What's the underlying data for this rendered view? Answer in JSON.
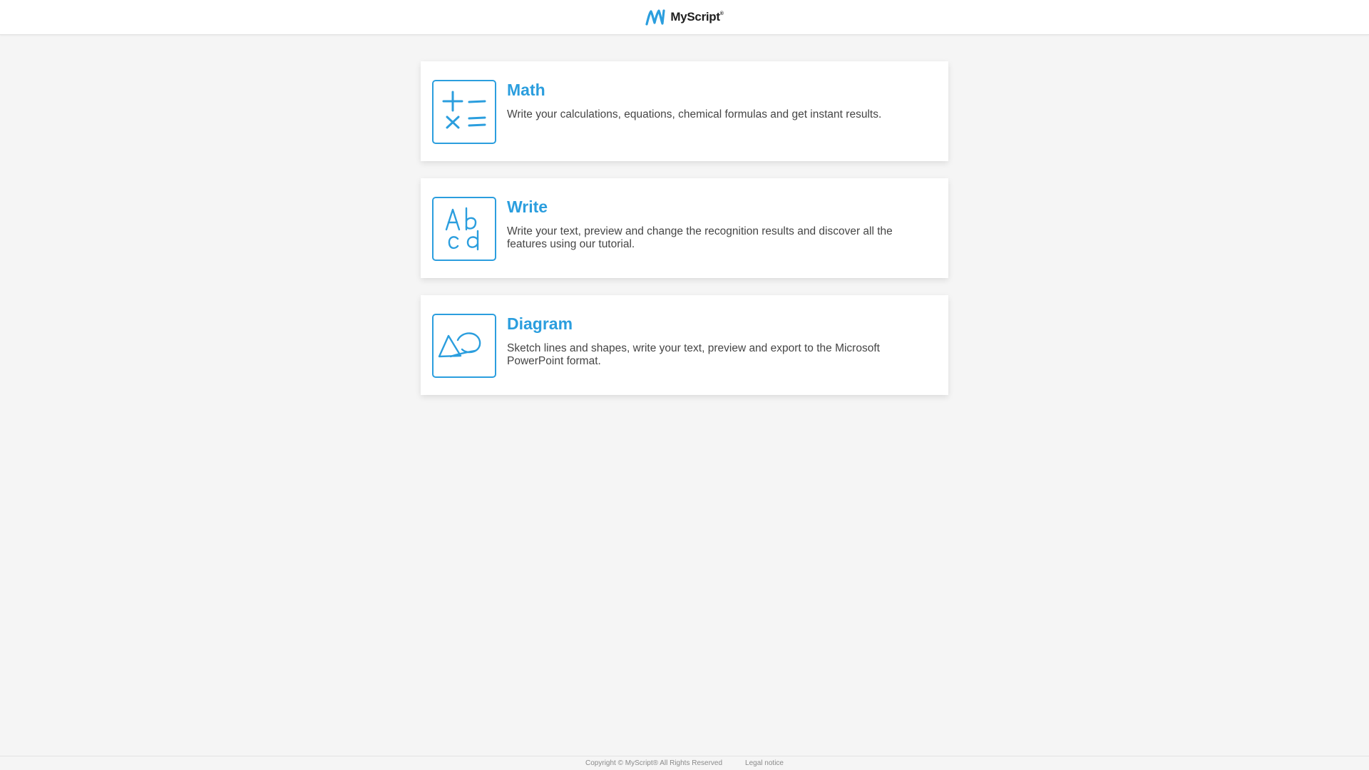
{
  "header": {
    "brand_name": "MyScript",
    "brand_registered_mark": "®",
    "brand_color": "#2b9ede",
    "logo_icon": "myscript-logo-icon"
  },
  "cards": [
    {
      "title": "Math",
      "description": "Write your calculations, equations, chemical formulas and get instant results.",
      "icon": "math-operators-icon"
    },
    {
      "title": "Write",
      "description": "Write your text, preview and change the recognition results and discover all the features using our tutorial.",
      "icon": "handwriting-abcd-icon"
    },
    {
      "title": "Diagram",
      "description": "Sketch lines and shapes, write your text, preview and export to the Microsoft PowerPoint format.",
      "icon": "diagram-shapes-icon"
    }
  ],
  "footer": {
    "copyright": "Copyright © MyScript® All Rights Reserved",
    "legal_link": "Legal notice"
  }
}
